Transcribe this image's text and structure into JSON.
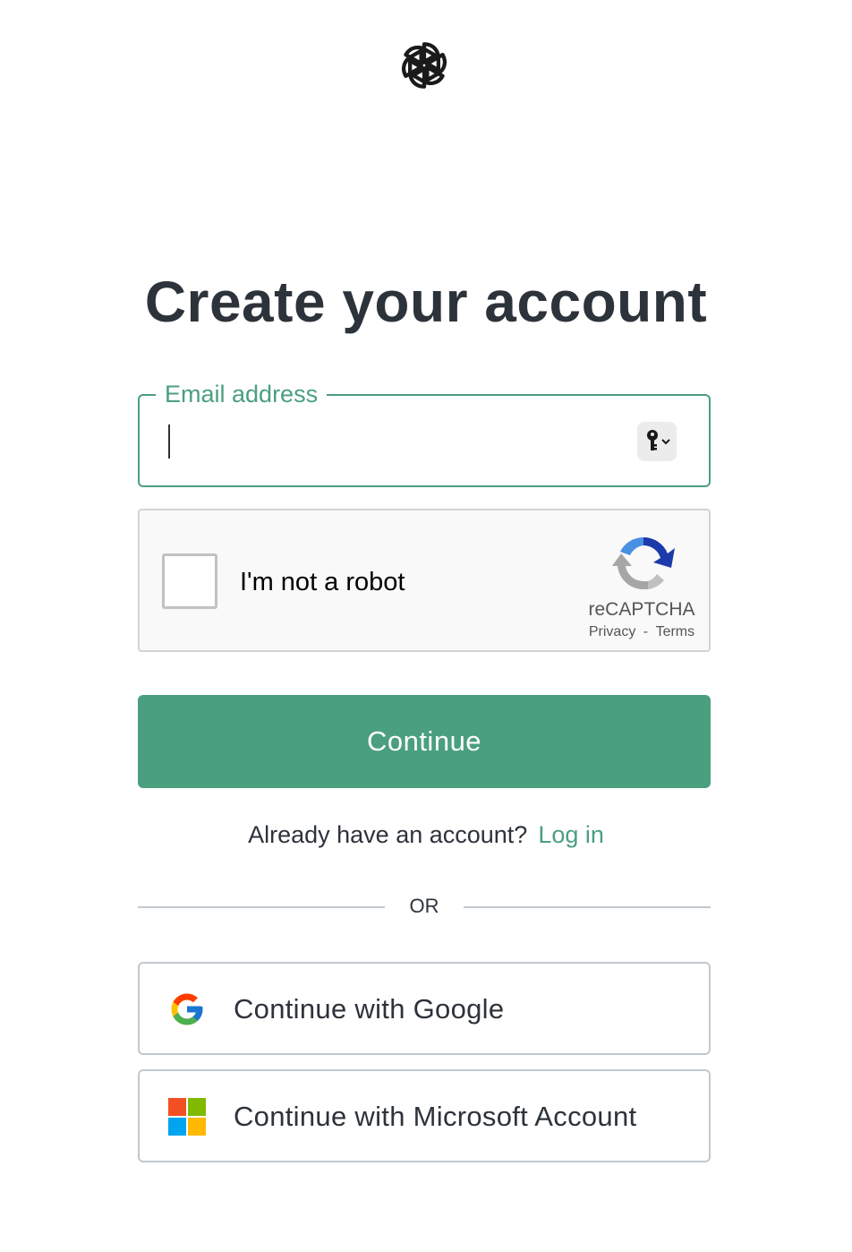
{
  "header": {
    "logo_icon": "openai-logo-icon"
  },
  "page": {
    "title": "Create your account"
  },
  "email": {
    "label": "Email address",
    "value": "",
    "placeholder": "",
    "key_icon": "key-chevron-icon"
  },
  "captcha": {
    "checkbox_label": "I'm not a robot",
    "checked": false,
    "brand": "reCAPTCHA",
    "privacy": "Privacy",
    "separator": "-",
    "terms": "Terms",
    "logo_icon": "recaptcha-logo-icon"
  },
  "actions": {
    "continue_label": "Continue"
  },
  "login": {
    "prompt": "Already have an account?",
    "link_label": "Log in"
  },
  "divider": {
    "label": "OR"
  },
  "social": {
    "google_label": "Continue with Google",
    "google_icon": "google-icon",
    "microsoft_label": "Continue with Microsoft Account",
    "microsoft_icon": "microsoft-icon"
  },
  "colors": {
    "accent": "#4a9f7f",
    "text": "#2d333a",
    "border": "#c2c8d0"
  }
}
